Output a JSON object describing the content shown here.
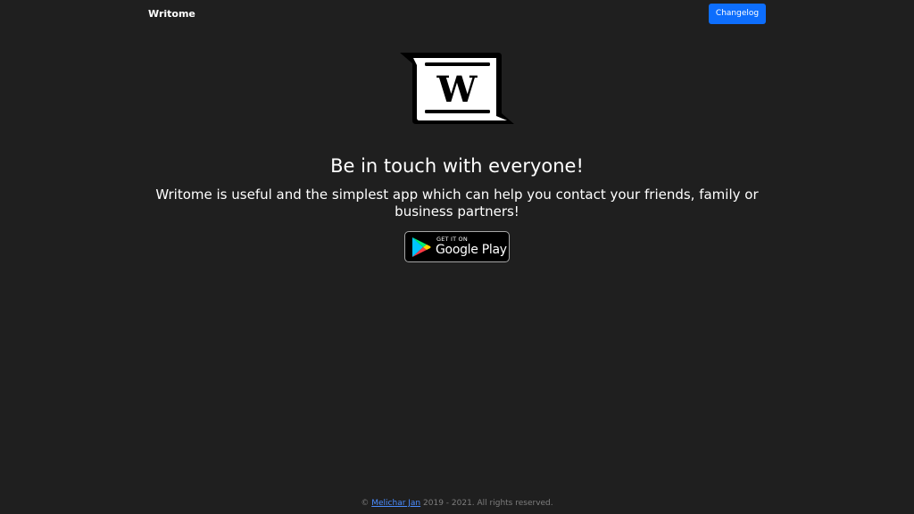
{
  "navbar": {
    "brand": "Writome",
    "changelog_label": "Changelog"
  },
  "logo": {
    "letter": "W"
  },
  "hero": {
    "headline": "Be in touch with everyone!",
    "subtitle": "Writome is useful and the simplest app which can help you contact your friends, family or business partners!"
  },
  "store_badge": {
    "small_text": "GET IT ON",
    "large_text": "Google Play"
  },
  "footer": {
    "copyright_symbol": "©",
    "author": "Melichar Jan",
    "rest": "2019 - 2021. All rights reserved."
  },
  "colors": {
    "background": "#1f1f1f",
    "primary": "#0d6efd",
    "link": "#4a8cff",
    "footer_text": "#7d7d7d"
  }
}
